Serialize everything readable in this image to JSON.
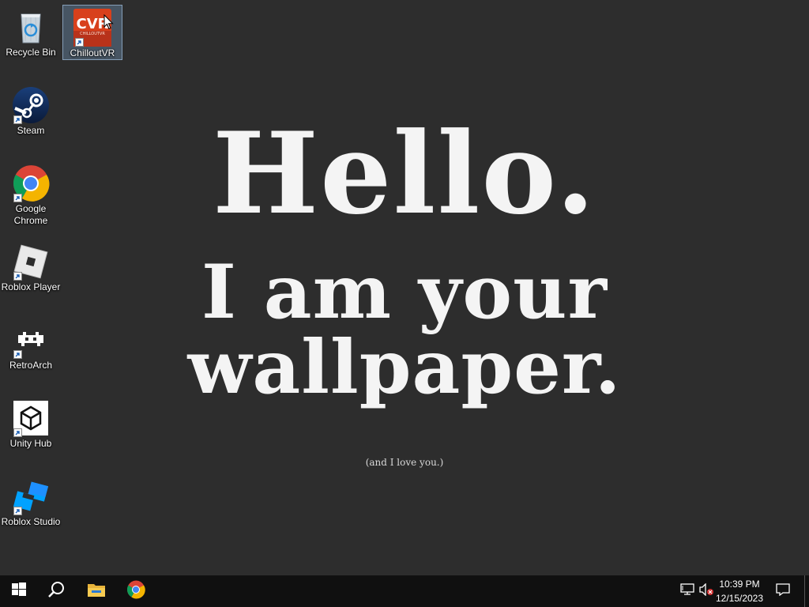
{
  "wallpaper": {
    "line1": "Hello.",
    "line2": "I am your",
    "line3": "wallpaper.",
    "line4": "(and I love you.)"
  },
  "desktop_icons": [
    {
      "label": "Recycle Bin",
      "icon": "recycle-bin-icon"
    },
    {
      "label": "ChilloutVR",
      "icon": "chilloutvr-icon",
      "selected": true
    },
    {
      "label": "Steam",
      "icon": "steam-icon"
    },
    {
      "label": "Google Chrome",
      "icon": "chrome-icon"
    },
    {
      "label": "Roblox Player",
      "icon": "roblox-player-icon"
    },
    {
      "label": "RetroArch",
      "icon": "retroarch-icon"
    },
    {
      "label": "Unity Hub",
      "icon": "unity-hub-icon"
    },
    {
      "label": "Roblox Studio",
      "icon": "roblox-studio-icon"
    }
  ],
  "taskbar": {
    "items": [
      "start-icon",
      "search-icon",
      "file-explorer-icon",
      "chrome-icon"
    ],
    "tray": {
      "time": "10:39 PM",
      "date": "12/15/2023",
      "icons": [
        "network-icon",
        "volume-muted-icon",
        "notification-icon"
      ]
    }
  },
  "colors": {
    "desktop_bg": "#2d2d2d",
    "taskbar_bg": "#101010",
    "chilloutvr_red": "#d8401c",
    "steam_blue": "#1b3a6b"
  }
}
